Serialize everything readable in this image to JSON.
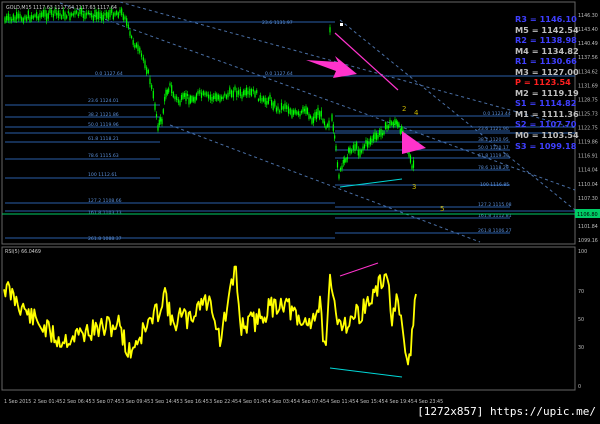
{
  "header": {
    "symbol_text": "GOLD,M15",
    "quote_text": "1117.63 1117.64 1117.63 1117.64"
  },
  "levels": [
    {
      "label": "R3 = 1146.10",
      "color": "#3f3fff"
    },
    {
      "label": "M5 = 1142.54",
      "color": "#bfbfbf"
    },
    {
      "label": "R2 = 1138.98",
      "color": "#3f3fff"
    },
    {
      "label": "M4 = 1134.82",
      "color": "#bfbfbf"
    },
    {
      "label": "R1 = 1130.66",
      "color": "#3f3fff"
    },
    {
      "label": "M3 = 1127.00",
      "color": "#bfbfbf"
    },
    {
      "label": "P  = 1123.54",
      "color": "#ff2020"
    },
    {
      "label": "M2 = 1119.19",
      "color": "#bfbfbf"
    },
    {
      "label": "S1 = 1114.82",
      "color": "#3f3fff"
    },
    {
      "label": "M1 = 1111.36",
      "color": "#bfbfbf"
    },
    {
      "label": "S2 = 1107.70",
      "color": "#3f3fff"
    },
    {
      "label": "M0 = 1103.54",
      "color": "#bfbfbf"
    },
    {
      "label": "S3 = 1099.18",
      "color": "#3f3fff"
    }
  ],
  "price_axis": [
    "1146.30",
    "1143.40",
    "1140.49",
    "1137.56",
    "1134.62",
    "1131.69",
    "1128.75",
    "1125.73",
    "1122.75",
    "1119.86",
    "1116.91",
    "1114.04",
    "1110.04",
    "1107.30",
    "1104.04",
    "1101.84",
    "1099.16"
  ],
  "current_price": "1106.80",
  "fib_labels": {
    "a0": "0.0 1127.64",
    "a236": "23.6 1124.01",
    "a382": "38.2 1121.86",
    "a50": "50.0 1119.96",
    "a618": "61.8 1118.21",
    "a786": "78.6 1115.63",
    "a100": "100 1112.61",
    "a1272": "127.2 1108.66",
    "a1618": "161.8 1103.73",
    "a2618": "261.8 1088.37",
    "b0": "0.0 1127.64",
    "b236": "23.6 1131.97",
    "c0": "0.0 1123.44",
    "c236": "23.6 1121.90",
    "c382": "38.2 1120.95",
    "c50": "50.0 1120.17",
    "c618": "61.8 1119.39",
    "c786": "78.6 1118.29",
    "c100": "100 1116.85",
    "c1272": "127.2 1115.08",
    "c1618": "161.8 1112.81",
    "c2618": "261.8 1106.27"
  },
  "wave_labels": {
    "w2": "2",
    "w3": "3",
    "w4": "4",
    "w5": "5"
  },
  "indicator": {
    "name": "RSI(5) 66.0469",
    "axis": [
      "100",
      "70",
      "50",
      "30",
      "0"
    ]
  },
  "time_axis": [
    "1 Sep 2015",
    "2 Sep 01:45",
    "2 Sep 06:45",
    "3 Sep 07:45",
    "3 Sep 09:45",
    "3 Sep 14:45",
    "3 Sep 16:45",
    "3 Sep 22:45",
    "4 Sep 01:45",
    "4 Sep 03:45",
    "4 Sep 07:45",
    "4 Sep 11:45",
    "4 Sep 15:45",
    "4 Sep 19:45",
    "4 Sep 23:45"
  ],
  "watermark": "[1272x857] https://upic.me/",
  "colors": {
    "candle": "#00ff00",
    "grid_line": "#1e90ff",
    "rsi": "#ffff00",
    "arrow": "#ff33cc",
    "divergence_up": "#00d8d8",
    "divergence_top": "#ff33cc",
    "current_line": "#00cc66"
  }
}
